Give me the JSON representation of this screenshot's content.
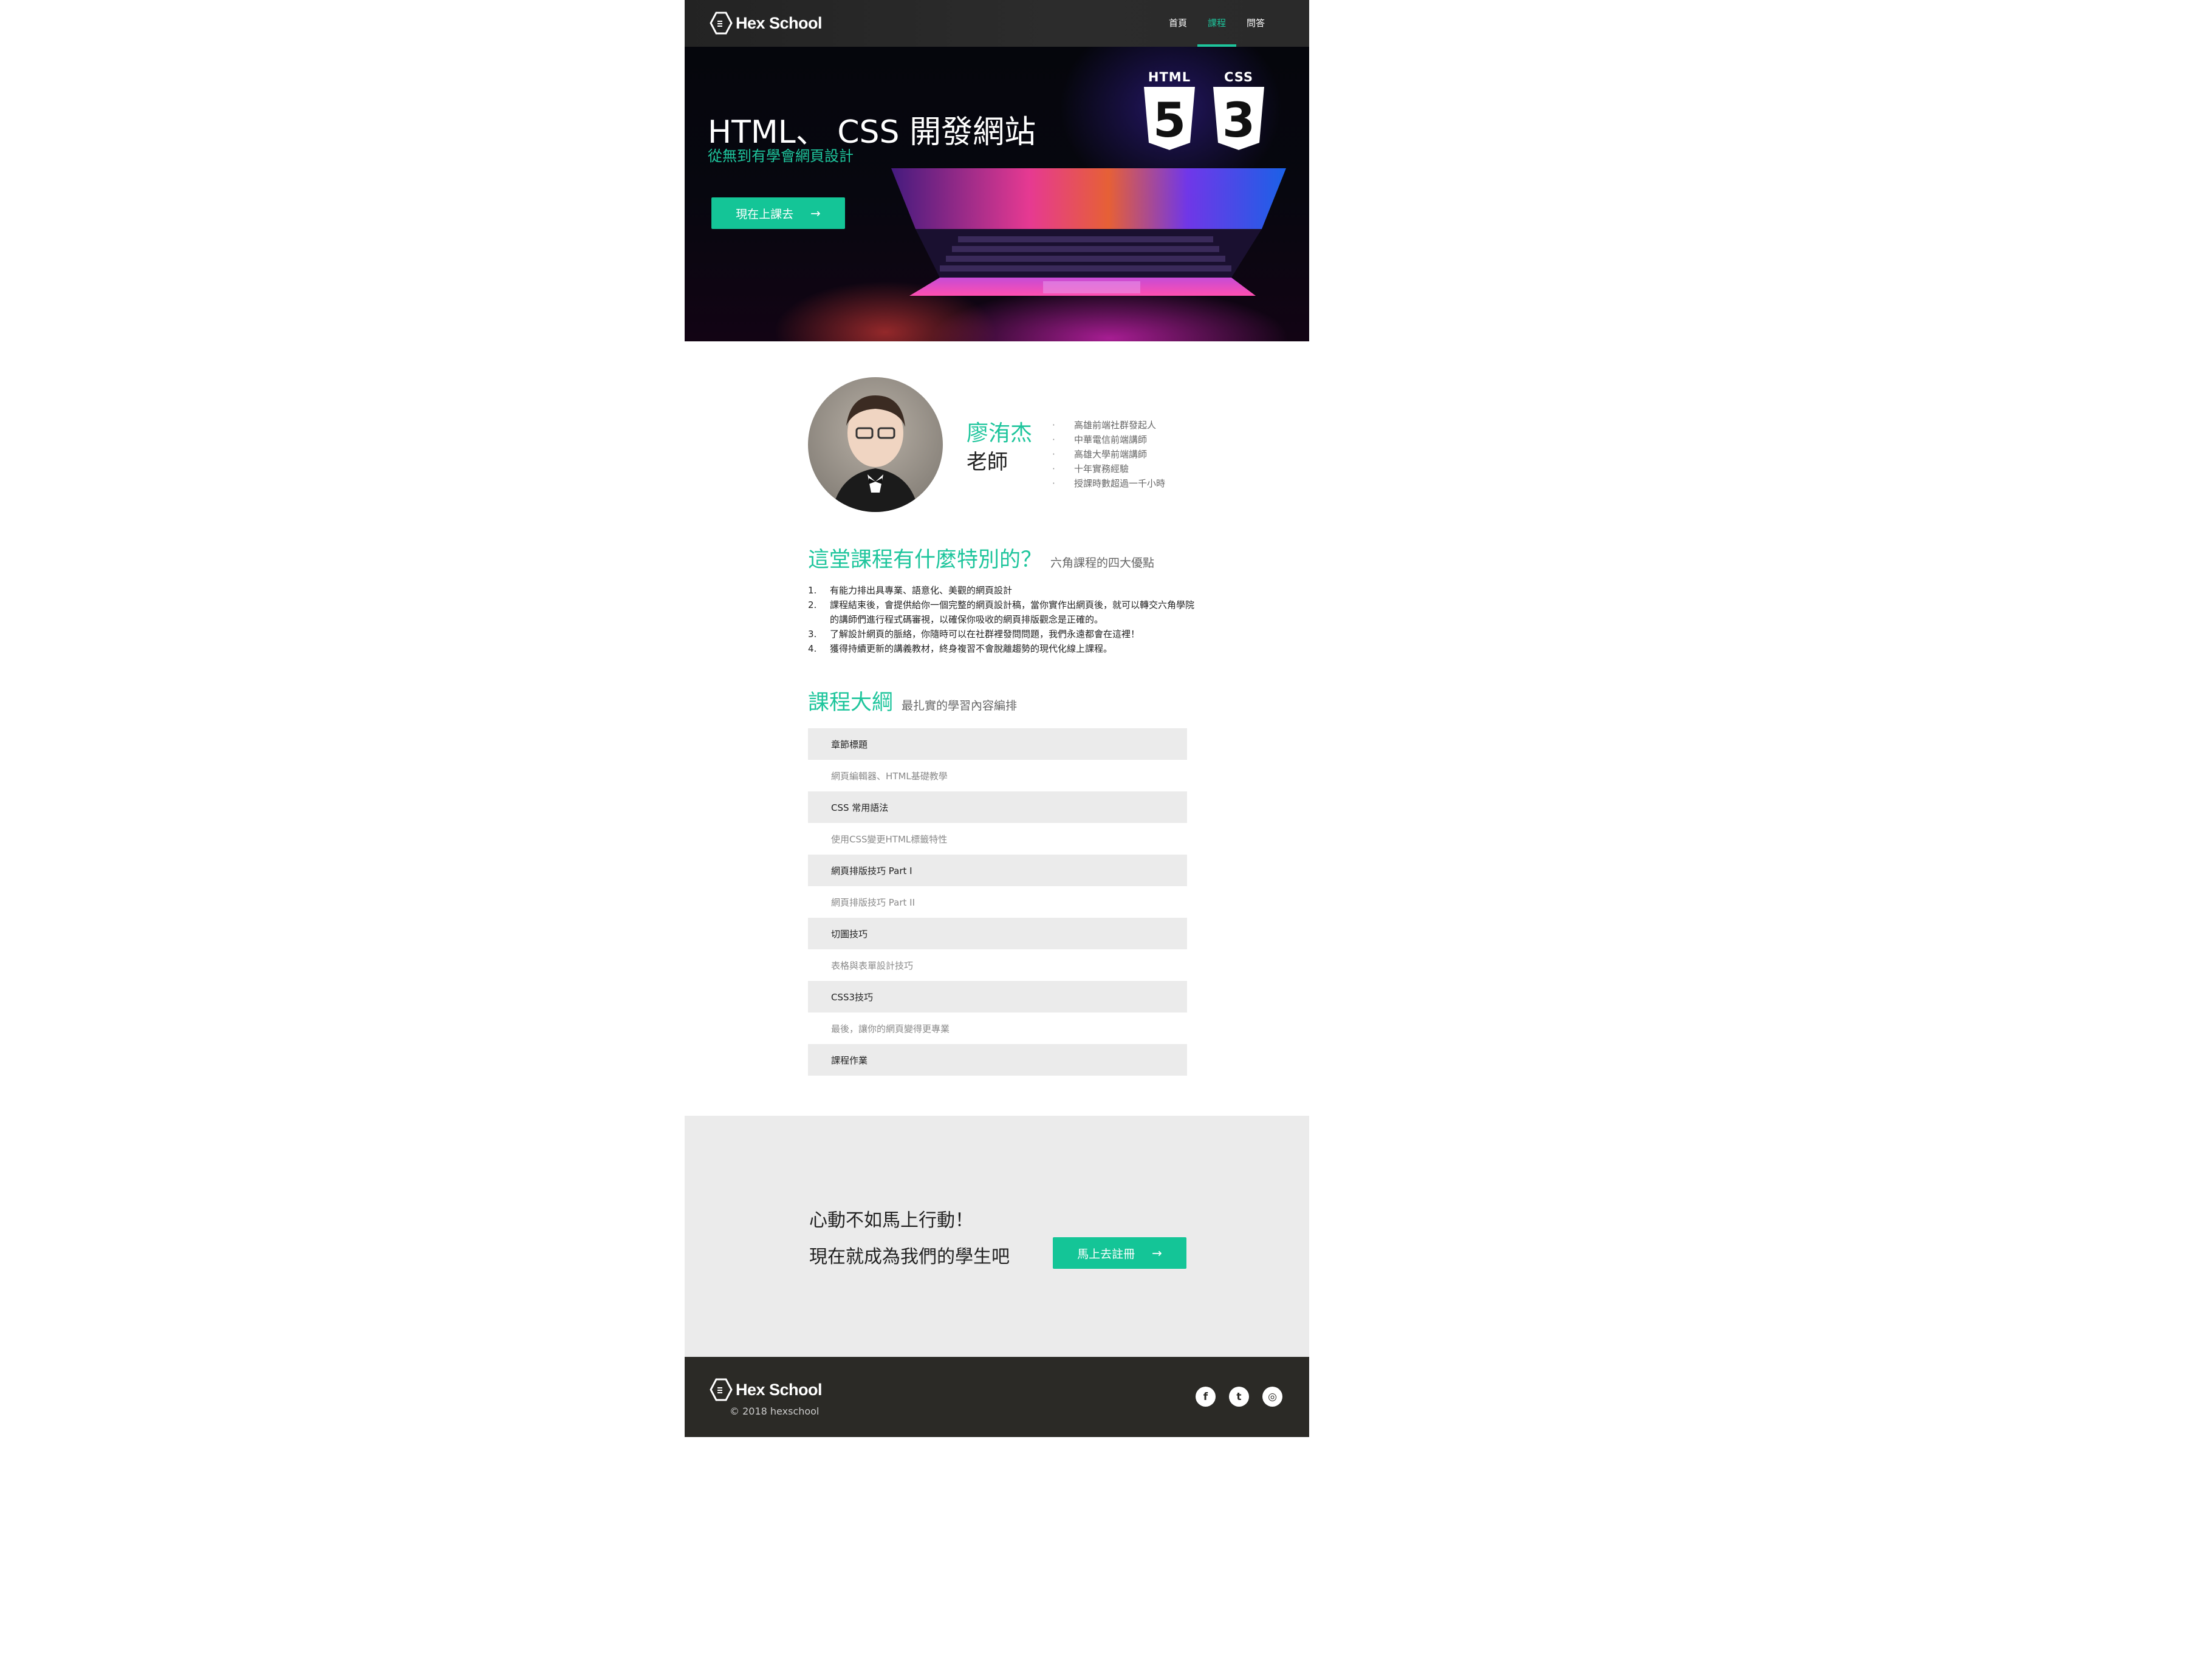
{
  "brand": {
    "name": "Hex School",
    "copyright": "© 2018 hexschool"
  },
  "nav": {
    "items": [
      {
        "label": "首頁",
        "active": false
      },
      {
        "label": "課程",
        "active": true
      },
      {
        "label": "問答",
        "active": false
      }
    ]
  },
  "hero": {
    "title": "HTML、 CSS 開發網站",
    "subtitle": "從無到有學會網頁設計",
    "button": "現在上課去",
    "badges": [
      {
        "label": "HTML",
        "digit": "5"
      },
      {
        "label": "CSS",
        "digit": "3"
      }
    ]
  },
  "teacher": {
    "name": "廖洧杰",
    "role": "老師",
    "credentials": [
      "高雄前端社群發起人",
      "中華電信前端講師",
      "高雄大學前端講師",
      "十年實務經驗",
      "授課時數超過一千小時"
    ]
  },
  "features": {
    "title": "這堂課程有什麼特別的？",
    "subtitle": "六角課程的四大優點",
    "items": [
      {
        "num": "1.",
        "text": "有能力排出具專業、語意化、美觀的網頁設計"
      },
      {
        "num": "2.",
        "text": "課程結束後，會提供給你一個完整的網頁設計稿，當你實作出網頁後，就可以轉交六角學院的講師們進行程式碼審視，以確保你吸收的網頁排版觀念是正確的。"
      },
      {
        "num": "3.",
        "text": "了解設計網頁的脈絡，你隨時可以在社群裡發問問題，我們永遠都會在這裡！"
      },
      {
        "num": "4.",
        "text": "獲得持續更新的講義教材，終身複習不會脫離趨勢的現代化線上課程。"
      }
    ]
  },
  "outline": {
    "title": "課程大綱",
    "subtitle": "最扎實的學習內容編排",
    "rows": [
      "章節標題",
      "網頁編輯器、HTML基礎教學",
      "CSS 常用語法",
      "使用CSS變更HTML標籤特性",
      "網頁排版技巧 Part I",
      "網頁排版技巧 Part II",
      "切圖技巧",
      "表格與表單設計技巧",
      "CSS3技巧",
      "最後，讓你的網頁變得更專業",
      "課程作業"
    ]
  },
  "cta": {
    "line1": "心動不如馬上行動！",
    "line2": "現在就成為我們的學生吧",
    "button": "馬上去註冊"
  },
  "socials": [
    {
      "icon": "facebook-icon",
      "glyph": "f"
    },
    {
      "icon": "twitter-icon",
      "glyph": "t"
    },
    {
      "icon": "instagram-icon",
      "glyph": "◎"
    }
  ],
  "colors": {
    "accent": "#1ec59c",
    "footer": "#2b2a26",
    "row_shade": "#ebebeb"
  }
}
